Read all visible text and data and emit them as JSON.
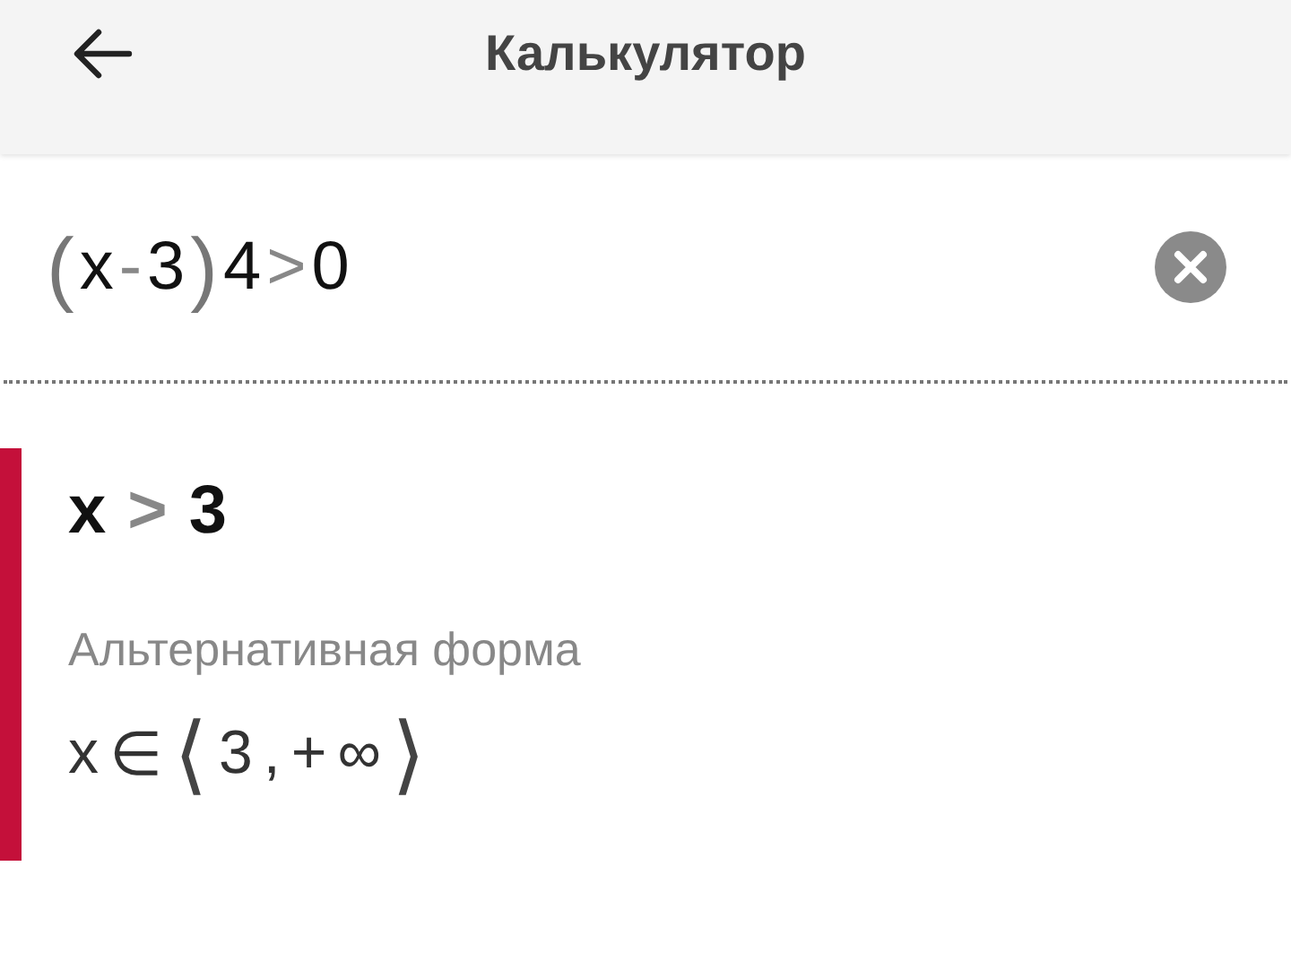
{
  "header": {
    "title": "Калькулятор"
  },
  "input": {
    "tokens": [
      {
        "text": "(",
        "kind": "paren"
      },
      {
        "text": "x",
        "kind": "term"
      },
      {
        "text": "-",
        "kind": "op"
      },
      {
        "text": "3",
        "kind": "term"
      },
      {
        "text": ")",
        "kind": "paren"
      },
      {
        "text": "4",
        "kind": "term"
      },
      {
        "text": ">",
        "kind": "op"
      },
      {
        "text": "0",
        "kind": "term"
      }
    ]
  },
  "result": {
    "tokens": [
      {
        "text": "x",
        "kind": "term"
      },
      {
        "text": ">",
        "kind": "op"
      },
      {
        "text": "3",
        "kind": "term"
      }
    ],
    "alternative_label": "Альтернативная форма",
    "alternative_tokens": [
      {
        "text": "x",
        "kind": "term"
      },
      {
        "text": "∈",
        "kind": "term"
      },
      {
        "text": "⟨",
        "kind": "paren"
      },
      {
        "text": "3",
        "kind": "term"
      },
      {
        "text": ",",
        "kind": "term"
      },
      {
        "text": "+",
        "kind": "term"
      },
      {
        "text": "∞",
        "kind": "term"
      },
      {
        "text": "⟩",
        "kind": "paren"
      }
    ]
  }
}
